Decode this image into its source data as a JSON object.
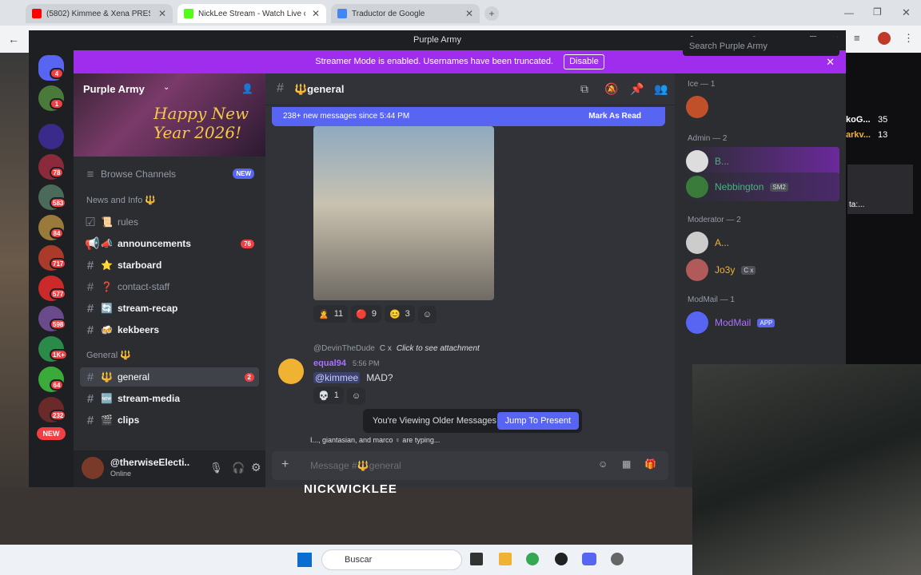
{
  "browser": {
    "tabs": [
      {
        "label": "(5802) Kimmee & Xena PRESS",
        "color": "#ff0000"
      },
      {
        "label": "NickLee Stream - Watch Live on",
        "color": "#53fc18"
      },
      {
        "label": "Traductor de Google",
        "color": "#4285f4"
      }
    ]
  },
  "discord": {
    "window_title": "Purple Army",
    "streamer_mode": {
      "text": "Streamer Mode is enabled. Usernames have been truncated.",
      "disable_label": "Disable"
    },
    "guild_badges": [
      "4",
      "1",
      "78",
      "583",
      "84",
      "717",
      "577",
      "598",
      "1K+",
      "64",
      "232"
    ],
    "new_pill": "NEW",
    "server": {
      "name": "Purple Army",
      "banner_text": "Happy New Year 2026!"
    },
    "browse_channels": {
      "label": "Browse Channels",
      "badge": "NEW"
    },
    "categories": {
      "news": "News and Info 🔱",
      "general": "General 🔱"
    },
    "channels": [
      {
        "name": "rules",
        "emoji": "📜",
        "state": "normal"
      },
      {
        "name": "announcements",
        "emoji": "📣",
        "state": "unread",
        "mentions": "76"
      },
      {
        "name": "starboard",
        "emoji": "⭐",
        "state": "unread"
      },
      {
        "name": "contact-staff",
        "emoji": "❓",
        "state": "normal"
      },
      {
        "name": "stream-recap",
        "emoji": "🔄",
        "state": "unread"
      },
      {
        "name": "kekbeers",
        "emoji": "🍻",
        "state": "unread"
      },
      {
        "name": "general",
        "emoji": "🔱",
        "state": "selected",
        "mentions": "2"
      },
      {
        "name": "stream-media",
        "emoji": "🆕",
        "state": "unread"
      },
      {
        "name": "clips",
        "emoji": "🎬",
        "state": "unread"
      }
    ],
    "user": {
      "name": "@therwiseElecti...",
      "status": "Online"
    },
    "header": {
      "channel": "🔱general",
      "search_placeholder": "Search Purple Army"
    },
    "new_messages": {
      "text": "238+ new messages since 5:44 PM",
      "action": "Mark As Read"
    },
    "reactions_1": [
      {
        "emoji": "🙎",
        "count": "11"
      },
      {
        "emoji": "🔴",
        "count": "9"
      },
      {
        "emoji": "😊",
        "count": "3"
      }
    ],
    "reply": {
      "author": "@DevinTheDude",
      "tag": "C x",
      "text": "Click to see attachment"
    },
    "message": {
      "author": "equal94",
      "time": "5:56 PM",
      "mention": "@kimmee",
      "text": "MAD?"
    },
    "reactions_2": [
      {
        "emoji": "💀",
        "count": "1"
      }
    ],
    "older_notice": {
      "text": "You're Viewing Older Messages",
      "action": "Jump To Present"
    },
    "typing": "I..., giantasian, and marco ♀ are typing...",
    "composer_placeholder": "Message #🔱general",
    "members": {
      "groups": [
        {
          "title": "Ice — 1",
          "members": [
            {
              "name": "",
              "color": "#dbdee1"
            }
          ]
        },
        {
          "title": "Admin — 2",
          "members": [
            {
              "name": "B...",
              "color": "#43b581"
            },
            {
              "name": "Nebbington",
              "color": "#43b581",
              "tag": "SM2"
            }
          ]
        },
        {
          "title": "Moderator — 2",
          "members": [
            {
              "name": "A...",
              "color": "#f0b232"
            },
            {
              "name": "Jo3y",
              "color": "#f0b232",
              "tag": "C x"
            }
          ]
        },
        {
          "title": "ModMail — 1",
          "members": [
            {
              "name": "ModMail",
              "color": "#a970ff",
              "tag": "APP"
            }
          ]
        }
      ]
    }
  },
  "side_text": {
    "a": "koG...",
    "b": "35",
    "c": "arkv...",
    "d": "13",
    "e": "ta:..."
  },
  "stream_overlay": "NICKWICKLEE",
  "taskbar": {
    "search": "Buscar"
  }
}
